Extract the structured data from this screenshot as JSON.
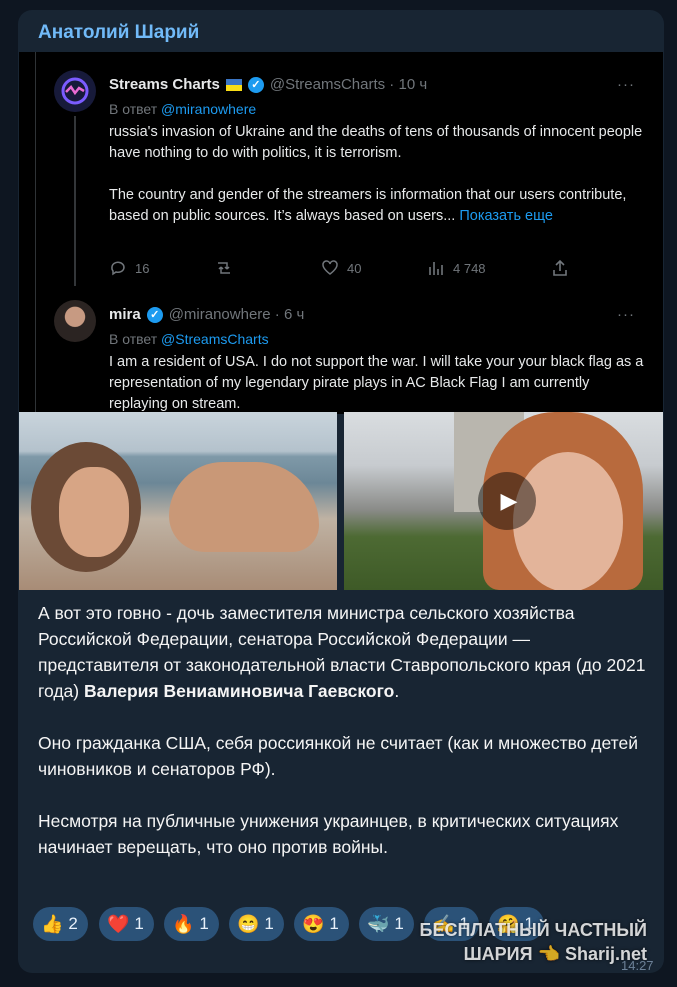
{
  "post": {
    "author": "Анатолий Шарий",
    "time": "14:27"
  },
  "tweet1": {
    "name": "Streams Charts",
    "handle_time": "@StreamsCharts · 10 ч",
    "reply_prefix": "В ответ",
    "reply_to": "@miranowhere",
    "para1": "russia's invasion of Ukraine and the deaths of tens of thousands of innocent people have nothing to do with politics, it is terrorism.",
    "para2": "The country and gender of the streamers is information that our users contribute, based on public sources. It’s always based on users...",
    "show_more": "Показать еще",
    "replies": "16",
    "likes": "40",
    "views": "4 748",
    "more": "···"
  },
  "tweet2": {
    "name": "mira",
    "handle_time": "@miranowhere · 6 ч",
    "reply_prefix": "В ответ",
    "reply_to": "@StreamsCharts",
    "text": "I am a resident of USA. I do not support the war. I will take your your black flag as a representation of my legendary pirate plays in AC Black Flag I am currently replaying on stream.",
    "more": "···"
  },
  "message": {
    "p1_text": "А вот это говно - дочь заместителя министра сельского хозяйства Российской Федерации,  сенатора Российской Федерации — представителя от законодательной власти Ставропольского края (до 2021 года) ",
    "p1_bold": "Валерия Вениаминовича Гаевского",
    "p1_end": ".",
    "p2": "Оно гражданка США, себя россиянкой не считает (как и множество детей чиновников и сенаторов РФ).",
    "p3": "Несмотря на публичные унижения украинцев, в критических ситуациях начинает верещать, что оно против войны."
  },
  "reactions": [
    {
      "emoji": "👍",
      "count": "2"
    },
    {
      "emoji": "❤️",
      "count": "1"
    },
    {
      "emoji": "🔥",
      "count": "1"
    },
    {
      "emoji": "😁",
      "count": "1"
    },
    {
      "emoji": "😍",
      "count": "1"
    },
    {
      "emoji": "🐳",
      "count": "1"
    },
    {
      "emoji": "✍️",
      "count": "1"
    },
    {
      "emoji": "🤗",
      "count": "1"
    }
  ],
  "watermark": {
    "line1": "БЕСПЛАТНЫЙ ЧАСТНЫЙ",
    "line2": "ШАРИЯ 👈 Sharij.net"
  },
  "colors": {
    "bg": "#0e1621",
    "bubble": "#182533",
    "author": "#71baf8",
    "reaction": "#2b5278",
    "tweet_link": "#1d9bf0"
  }
}
